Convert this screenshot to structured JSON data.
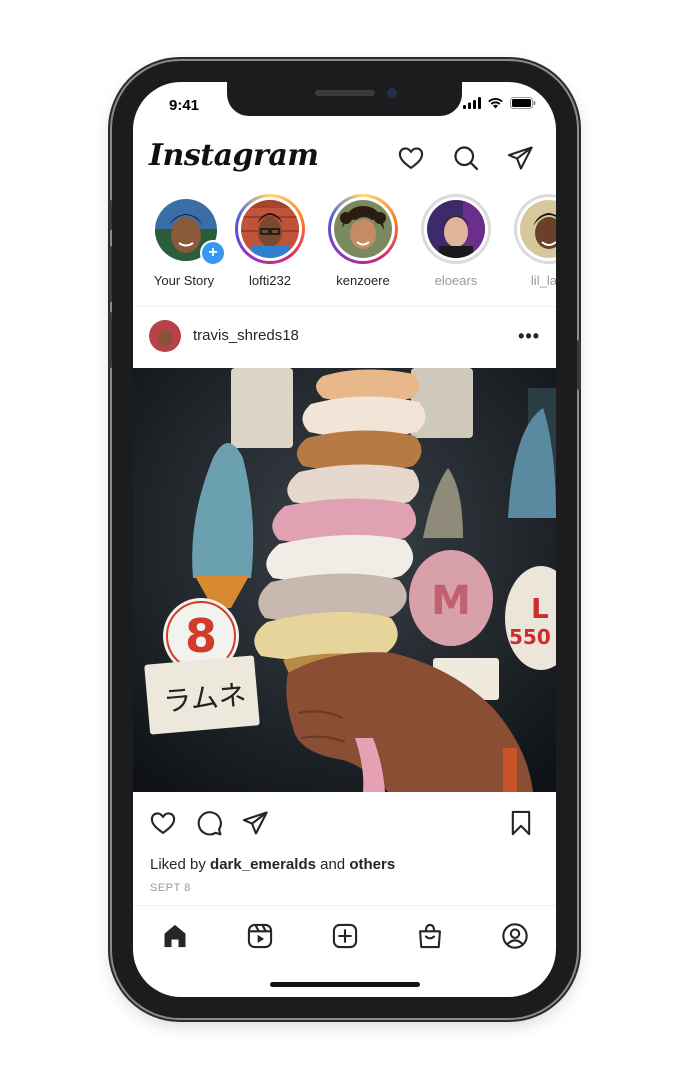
{
  "status_bar": {
    "time": "9:41"
  },
  "header": {
    "logo_text": "Instagram"
  },
  "stories": [
    {
      "label": "Your Story",
      "state": "own"
    },
    {
      "label": "lofti232",
      "state": "active"
    },
    {
      "label": "kenzoere",
      "state": "active"
    },
    {
      "label": "eloears",
      "state": "seen"
    },
    {
      "label": "lil_lapi",
      "state": "seen"
    }
  ],
  "post": {
    "username": "travis_shreds18",
    "more_label": "•••",
    "liked_prefix": "Liked by",
    "liked_user": "dark_emeralds",
    "liked_and": "and",
    "liked_others": "others",
    "date": "SEPT 8"
  },
  "colors": {
    "accent_blue": "#3897f0",
    "story_gradient": [
      "#feda75",
      "#fa7e1e",
      "#d62976",
      "#962fbf",
      "#4f5bd5"
    ],
    "text": "#262626",
    "muted": "#9a9a9a"
  },
  "icons": {
    "header": [
      "heart-icon",
      "search-icon",
      "direct-message-icon"
    ],
    "actions": [
      "like-icon",
      "comment-icon",
      "share-icon",
      "bookmark-icon"
    ],
    "tabs": [
      "home-icon",
      "reels-icon",
      "create-icon",
      "shop-icon",
      "profile-icon"
    ]
  }
}
